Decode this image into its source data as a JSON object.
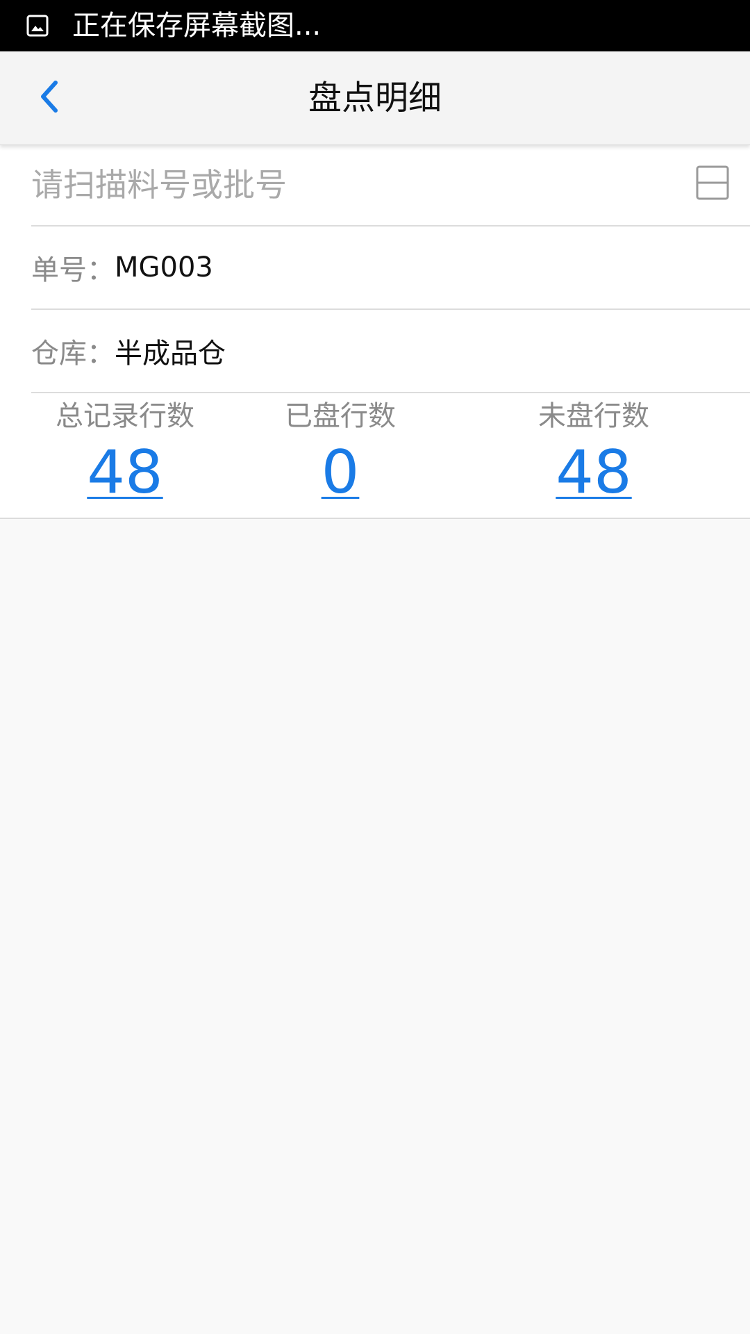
{
  "status_bar": {
    "icon": "image-icon",
    "text": "正在保存屏幕截图..."
  },
  "header": {
    "title": "盘点明细",
    "back_icon": "chevron-left-icon"
  },
  "search": {
    "placeholder": "请扫描料号或批号",
    "value": "",
    "scan_icon": "scan-icon"
  },
  "order": {
    "label": "单号：",
    "value": "MG003"
  },
  "warehouse": {
    "label": "仓库：",
    "value": "半成品仓"
  },
  "stats": [
    {
      "label": "总记录行数",
      "value": "48"
    },
    {
      "label": "已盘行数",
      "value": "0"
    },
    {
      "label": "未盘行数",
      "value": "48"
    }
  ],
  "colors": {
    "accent": "#1a7be6",
    "status_bar_bg": "#000000",
    "header_bg": "#f4f4f4",
    "page_bg": "#f9f9f9"
  }
}
